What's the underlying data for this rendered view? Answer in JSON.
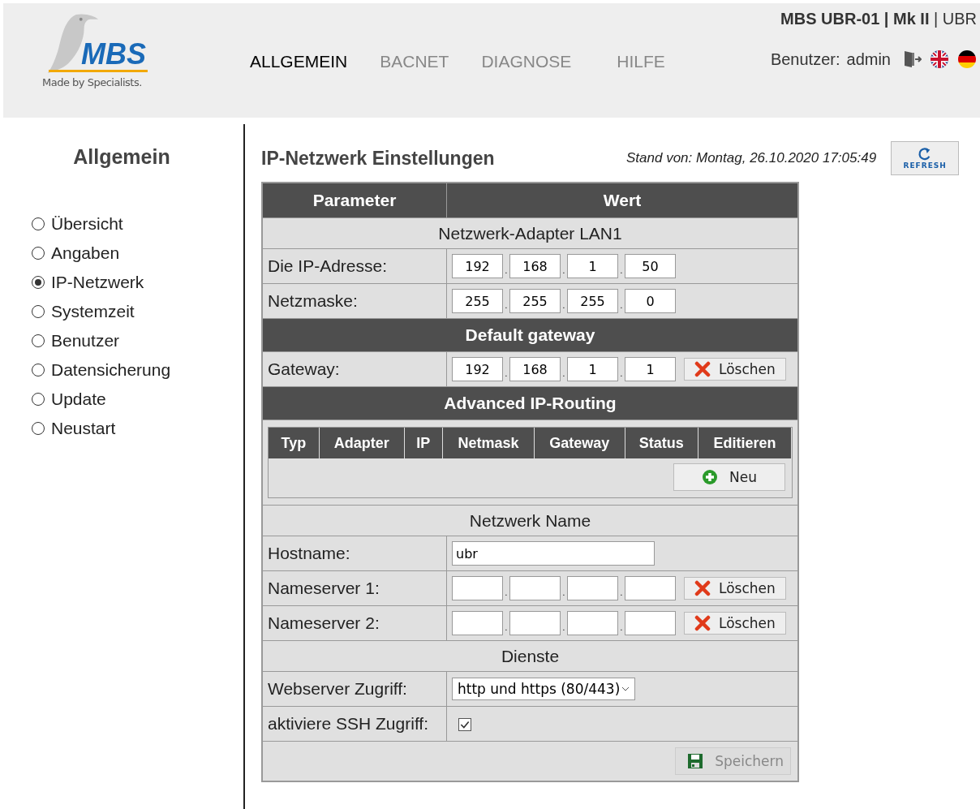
{
  "header": {
    "logo": {
      "brand": "MBS",
      "tagline": "Made by Specialists."
    },
    "nav": [
      {
        "label": "ALLGEMEIN",
        "selected": true
      },
      {
        "label": "BACNET",
        "selected": false
      },
      {
        "label": "DIAGNOSE",
        "selected": false
      },
      {
        "label": "HILFE",
        "selected": false
      }
    ],
    "device_title": "**MBS UBR-01 | Mk II** | UBR",
    "user_label": "Benutzer:",
    "user": "admin"
  },
  "sidebar": {
    "title": "Allgemein",
    "items": [
      {
        "label": "Übersicht",
        "selected": false
      },
      {
        "label": "Angaben",
        "selected": false
      },
      {
        "label": "IP-Netzwerk",
        "selected": true
      },
      {
        "label": "Systemzeit",
        "selected": false
      },
      {
        "label": "Benutzer",
        "selected": false
      },
      {
        "label": "Datensicherung",
        "selected": false
      },
      {
        "label": "Update",
        "selected": false
      },
      {
        "label": "Neustart",
        "selected": false
      }
    ]
  },
  "main": {
    "title": "IP-Netzwerk Einstellungen",
    "timestamp": "Stand von: Montag, 26.10.2020 17:05:49",
    "refresh_button": "REFRESH"
  },
  "table": {
    "columns": [
      "Parameter",
      "Wert"
    ],
    "rows": [
      {
        "kind": "subheading",
        "label": "Netzwerk-Adapter LAN1"
      },
      {
        "kind": "ip",
        "label": "Die IP-Adresse:",
        "octets": [
          "192",
          "168",
          "1",
          "50"
        ],
        "separator": "."
      },
      {
        "kind": "ip",
        "label": "Netzmaske:",
        "octets": [
          "255",
          "255",
          "255",
          "0"
        ],
        "separator": "."
      },
      {
        "kind": "heading",
        "label": "Default gateway"
      },
      {
        "kind": "ip",
        "label": "Gateway:",
        "octets": [
          "192",
          "168",
          "1",
          "1"
        ],
        "separator": ".",
        "button": "Löschen"
      },
      {
        "kind": "heading",
        "label": "Advanced IP-Routing"
      },
      {
        "kind": "routing",
        "columns": [
          "Typ",
          "Adapter",
          "IP",
          "Netmask",
          "Gateway",
          "Status",
          "Editieren"
        ],
        "button": "Neu"
      },
      {
        "kind": "subheading",
        "label": "Netzwerk Name"
      },
      {
        "kind": "text",
        "label": "Hostname:",
        "value": "ubr"
      },
      {
        "kind": "ip",
        "label": "Nameserver 1:",
        "octets": [],
        "separator": ".",
        "button": "Löschen"
      },
      {
        "kind": "ip",
        "label": "Nameserver 2:",
        "octets": [],
        "separator": ".",
        "button": "Löschen"
      },
      {
        "kind": "subheading",
        "label": "Dienste"
      },
      {
        "kind": "select",
        "label": "Webserver Zugriff:",
        "value": "http und https (80/443)"
      },
      {
        "kind": "checkbox",
        "label": "aktiviere SSH Zugriff:",
        "checked": true
      },
      {
        "kind": "actions",
        "button": "Speichern",
        "disabled": true
      }
    ]
  }
}
